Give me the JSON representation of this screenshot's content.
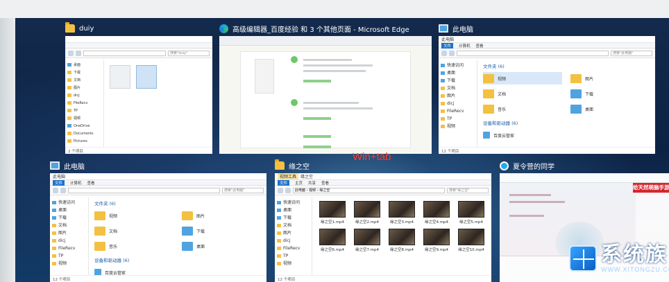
{
  "tiles": {
    "t1": {
      "title": "duiy",
      "icon": "folder-icon",
      "search": "搜索\"duiy\"",
      "status": "2 个项目",
      "sidebar": [
        "桌面",
        "下载",
        "文档",
        "图片",
        "dicj",
        "FileRecv",
        "TP",
        "视频",
        "OneDrive",
        "Documents",
        "Pictures",
        "此电脑",
        "网络"
      ]
    },
    "t2": {
      "title": "高级编辑器_百度经验 和 3 个其他页面 - Microsoft Edge",
      "icon": "edge-icon"
    },
    "t3": {
      "title": "此电脑",
      "icon": "pc-icon",
      "ribbon": [
        "文件",
        "计算机",
        "查看"
      ],
      "address": "此电脑",
      "search": "搜索\"此电脑\"",
      "group1": "文件夹 (6)",
      "group2": "设备和驱动器 (6)",
      "folders": [
        "视频",
        "图片",
        "文档",
        "下载",
        "音乐",
        "桌面"
      ],
      "sidebar": [
        "快速访问",
        "桌面",
        "下载",
        "文档",
        "图片",
        "dicj",
        "FileRecv",
        "TP",
        "视频"
      ],
      "status": "12 个项目",
      "drive": "百度云管家"
    },
    "t4": {
      "title": "此电脑",
      "icon": "pc-icon",
      "ribbon": [
        "文件",
        "计算机",
        "查看"
      ],
      "address": "此电脑",
      "search": "搜索\"此电脑\"",
      "group1": "文件夹 (6)",
      "group2": "设备和驱动器 (6)",
      "folders": [
        "视频",
        "图片",
        "文档",
        "下载",
        "音乐",
        "桌面"
      ],
      "sidebar": [
        "快速访问",
        "桌面",
        "下载",
        "文档",
        "图片",
        "dicj",
        "FileRecv",
        "TP",
        "视频"
      ],
      "status": "12 个项目",
      "drive": "百度云管家"
    },
    "t5": {
      "title": "缘之空",
      "icon": "folder-icon",
      "ribbon": [
        "文件",
        "主页",
        "共享",
        "查看"
      ],
      "ribbon_active": "视频工具",
      "address": "此电脑 › 视频 › 缘之空",
      "search": "搜索\"缘之空\"",
      "videos": [
        "缘之空1.mp4",
        "缘之空2.mp4",
        "缘之空3.mp4",
        "缘之空4.mp4",
        "缘之空5.mp4",
        "缘之空6.mp4",
        "缘之空7.mp4",
        "缘之空8.mp4",
        "缘之空9.mp4",
        "缘之空10.mp4"
      ],
      "sidebar": [
        "快速访问",
        "桌面",
        "下载",
        "文档",
        "图片",
        "dicj",
        "FileRecv",
        "TP",
        "视频"
      ],
      "status": "12 个项目"
    },
    "t6": {
      "title": "夏令营的同学",
      "icon": "qq-icon",
      "banner": "给天然萌脑手游"
    }
  },
  "overlay": {
    "label": "Win+tab"
  },
  "logo": {
    "cn": "系统族",
    "en": "WWW.XITONGZU.COM"
  }
}
